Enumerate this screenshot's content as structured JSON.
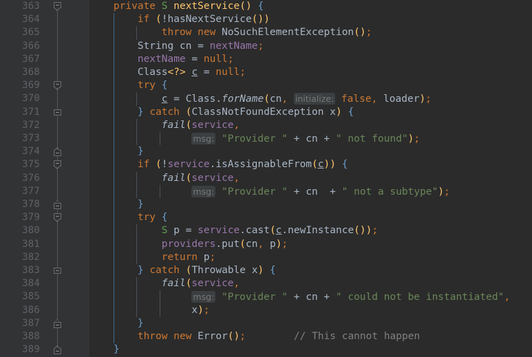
{
  "editor": {
    "theme": "darcula",
    "background": "#2b2b2b",
    "gutter_background": "#313335",
    "line_number_color": "#606366",
    "first_line": 363,
    "last_line": 389,
    "line_height": 19.2,
    "char_width": 8.4,
    "font_size": 14.5,
    "indent_guide_color": "#4b5059",
    "indent_guide_active_color": "#3c6e8f"
  },
  "line_numbers": [
    "363",
    "364",
    "365",
    "366",
    "367",
    "368",
    "369",
    "370",
    "371",
    "372",
    "373",
    "374",
    "375",
    "376",
    "377",
    "378",
    "379",
    "380",
    "381",
    "382",
    "383",
    "384",
    "385",
    "386",
    "387",
    "388",
    "389"
  ],
  "fold_markers": [
    {
      "line": 363,
      "type": "down",
      "label": "collapse-region"
    },
    {
      "line": 369,
      "type": "down",
      "label": "collapse-region"
    },
    {
      "line": 371,
      "type": "flat",
      "label": "collapse-region"
    },
    {
      "line": 374,
      "type": "up",
      "label": "collapse-region"
    },
    {
      "line": 375,
      "type": "down",
      "label": "collapse-region"
    },
    {
      "line": 378,
      "type": "up",
      "label": "collapse-region"
    },
    {
      "line": 379,
      "type": "down",
      "label": "collapse-region"
    },
    {
      "line": 383,
      "type": "flat",
      "label": "collapse-region"
    },
    {
      "line": 387,
      "type": "up",
      "label": "collapse-region"
    },
    {
      "line": 389,
      "type": "up",
      "label": "collapse-region"
    }
  ],
  "code": {
    "language": "java",
    "lines": [
      {
        "n": 363,
        "text": "    private S nextService() {"
      },
      {
        "n": 364,
        "text": "        if (!hasNextService())"
      },
      {
        "n": 365,
        "text": "            throw new NoSuchElementException();"
      },
      {
        "n": 366,
        "text": "        String cn = nextName;"
      },
      {
        "n": 367,
        "text": "        nextName = null;"
      },
      {
        "n": 368,
        "text": "        Class<?> c = null;"
      },
      {
        "n": 369,
        "text": "        try {"
      },
      {
        "n": 370,
        "text": "            c = Class.forName(cn, initialize: false, loader);"
      },
      {
        "n": 371,
        "text": "        } catch (ClassNotFoundException x) {"
      },
      {
        "n": 372,
        "text": "            fail(service,"
      },
      {
        "n": 373,
        "text": "                 msg: \"Provider \" + cn + \" not found\");"
      },
      {
        "n": 374,
        "text": "        }"
      },
      {
        "n": 375,
        "text": "        if (!service.isAssignableFrom(c)) {"
      },
      {
        "n": 376,
        "text": "            fail(service,"
      },
      {
        "n": 377,
        "text": "                 msg: \"Provider \" + cn  + \" not a subtype\");"
      },
      {
        "n": 378,
        "text": "        }"
      },
      {
        "n": 379,
        "text": "        try {"
      },
      {
        "n": 380,
        "text": "            S p = service.cast(c.newInstance());"
      },
      {
        "n": 381,
        "text": "            providers.put(cn, p);"
      },
      {
        "n": 382,
        "text": "            return p;"
      },
      {
        "n": 383,
        "text": "        } catch (Throwable x) {"
      },
      {
        "n": 384,
        "text": "            fail(service,"
      },
      {
        "n": 385,
        "text": "                 msg: \"Provider \" + cn + \" could not be instantiated\","
      },
      {
        "n": 386,
        "text": "                 x);"
      },
      {
        "n": 387,
        "text": "        }"
      },
      {
        "n": 388,
        "text": "        throw new Error();        // This cannot happen"
      },
      {
        "n": 389,
        "text": "    }"
      }
    ]
  },
  "parameter_hints": [
    {
      "line": 370,
      "name": "initialize:"
    },
    {
      "line": 373,
      "name": "msg:"
    },
    {
      "line": 377,
      "name": "msg:"
    },
    {
      "line": 385,
      "name": "msg:"
    }
  ],
  "tokens": {
    "keywords": [
      "private",
      "if",
      "throw",
      "new",
      "try",
      "catch",
      "return"
    ],
    "literals": [
      "null",
      "false"
    ],
    "types": [
      "S",
      "String",
      "Class",
      "NoSuchElementException",
      "ClassNotFoundException",
      "Throwable",
      "Error"
    ],
    "strings": [
      "\"Provider \"",
      "\" not found\"",
      "\" not a subtype\"",
      "\" could not be instantiated\""
    ],
    "comments": [
      "// This cannot happen"
    ],
    "fields": [
      "nextName",
      "providers",
      "service"
    ],
    "methods": [
      "nextService",
      "hasNextService",
      "forName",
      "fail",
      "isAssignableFrom",
      "cast",
      "newInstance",
      "put"
    ]
  },
  "colors": {
    "keyword": "#cc7832",
    "string": "#6a8759",
    "comment": "#808080",
    "field": "#9876aa",
    "method": "#ffc66d",
    "default_text": "#a9b7c6",
    "number": "#6897bb",
    "hint_bg": "#3b3f41",
    "hint_fg": "#787878"
  }
}
